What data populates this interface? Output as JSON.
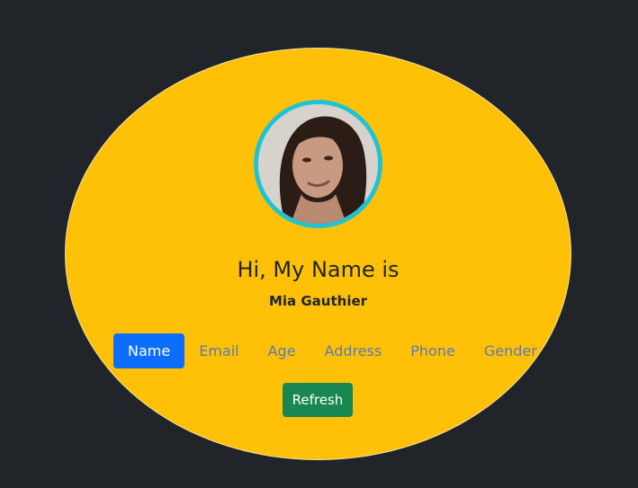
{
  "profile": {
    "greeting": "Hi, My Name is",
    "value": "Mia Gauthier",
    "avatar_icon": "user-photo"
  },
  "tabs": [
    {
      "label": "Name",
      "active": true
    },
    {
      "label": "Email",
      "active": false
    },
    {
      "label": "Age",
      "active": false
    },
    {
      "label": "Address",
      "active": false
    },
    {
      "label": "Phone",
      "active": false
    },
    {
      "label": "Gender",
      "active": false
    }
  ],
  "actions": {
    "refresh_label": "Refresh"
  },
  "colors": {
    "background": "#212529",
    "card": "#ffc107",
    "ring": "#1fc3d4",
    "active_tab": "#0d6efd",
    "tab_text": "#5a7ab3",
    "refresh_button": "#198754"
  }
}
